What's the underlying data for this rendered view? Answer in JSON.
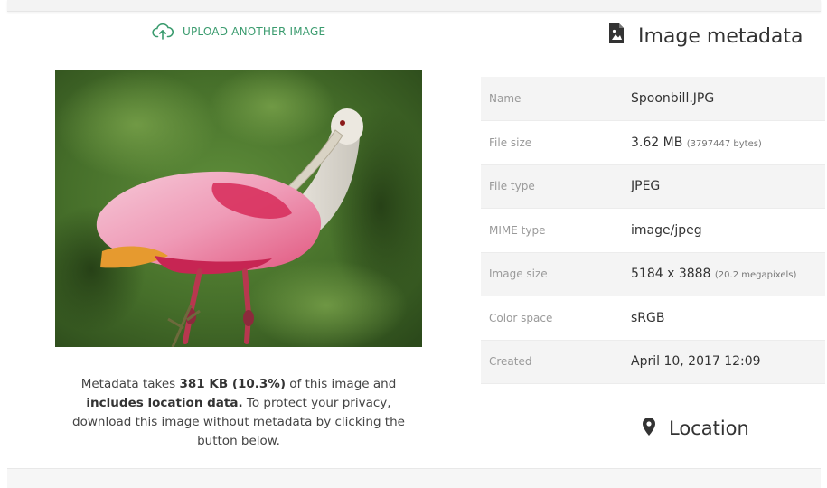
{
  "upload": {
    "label": "UPLOAD ANOTHER IMAGE",
    "icon": "cloud-upload-icon"
  },
  "photo": {
    "subject": "spoonbill-photo"
  },
  "privacy": {
    "text1": "Metadata takes ",
    "size_bold": "381 KB (10.3%)",
    "text2": " of this image and ",
    "location_bold": "includes location data.",
    "text3": " To protect your privacy, download this image without metadata by clicking the button below."
  },
  "metadata": {
    "title": "Image metadata",
    "icon": "image-file-icon",
    "rows": [
      {
        "label": "Name",
        "value": "Spoonbill.JPG",
        "note": ""
      },
      {
        "label": "File size",
        "value": "3.62 MB",
        "note": "(3797447 bytes)"
      },
      {
        "label": "File type",
        "value": "JPEG",
        "note": ""
      },
      {
        "label": "MIME type",
        "value": "image/jpeg",
        "note": ""
      },
      {
        "label": "Image size",
        "value": "5184 x 3888",
        "note": "(20.2 megapixels)"
      },
      {
        "label": "Color space",
        "value": "sRGB",
        "note": ""
      },
      {
        "label": "Created",
        "value": "April 10, 2017 12:09",
        "note": ""
      }
    ]
  },
  "location": {
    "title": "Location",
    "icon": "map-marker-icon"
  },
  "colors": {
    "accent": "#3a9b6e",
    "row_alt": "#f4f4f4"
  }
}
